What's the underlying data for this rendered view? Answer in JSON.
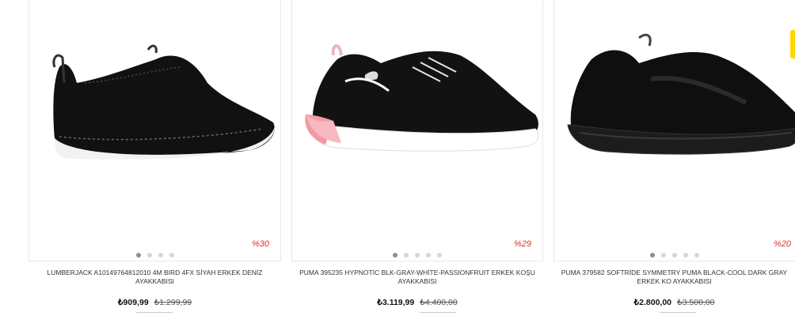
{
  "products": [
    {
      "title": "LUMBERJACK A10149764812010 4M BIRD 4FX SİYAH ERKEK DENİZ AYAKKABISI",
      "price": "₺909,99",
      "old_price": "₺1.299,99",
      "discount": "%30",
      "dots": 4,
      "active_dot": 0,
      "image_icon": "black-slip-on-shoe"
    },
    {
      "title": "PUMA 395235 HYPNOTİC BLK-GRAY-WHİTE-PASSIONFRUIT ERKEK KOŞU AYAKKABISI",
      "price": "₺3.119,99",
      "old_price": "₺4.400,00",
      "discount": "%29",
      "dots": 5,
      "active_dot": 0,
      "image_icon": "puma-running-shoe-pink-sole"
    },
    {
      "title": "PUMA 379582 SOFTRİDE SYMMETRY PUMA BLACK-COOL DARK GRAY ERKEK KO AYAKKABISI",
      "price": "₺2.800,00",
      "old_price": "₺3.500,00",
      "discount": "%20",
      "dots": 5,
      "active_dot": 0,
      "image_icon": "puma-all-black-running-shoe"
    }
  ],
  "colors": {
    "discount": "#e0312b",
    "dot_active": "#8e8e8e",
    "dot_inactive": "#d6d6d6",
    "modal_button": "#1a73e8"
  }
}
